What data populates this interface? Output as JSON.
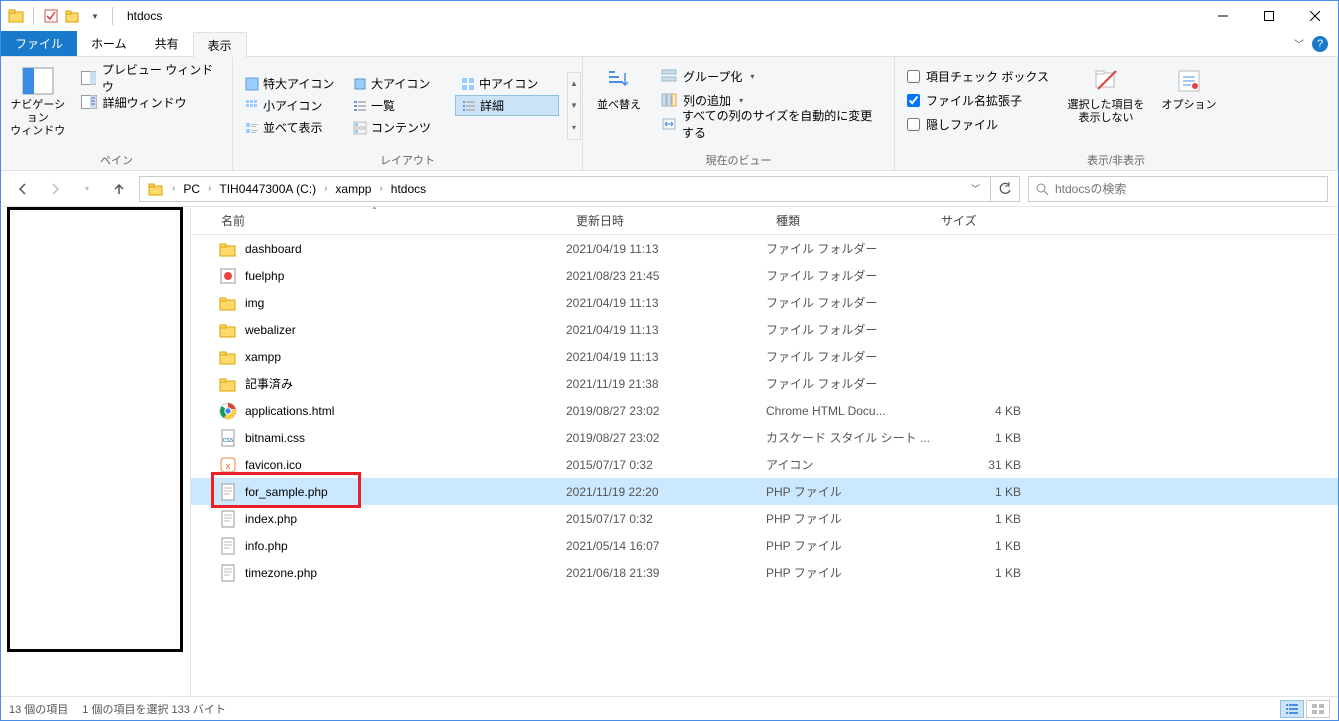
{
  "window": {
    "title": "htdocs"
  },
  "tabs": {
    "file": "ファイル",
    "home": "ホーム",
    "share": "共有",
    "view": "表示"
  },
  "ribbon": {
    "pane": {
      "nav": "ナビゲーション\nウィンドウ",
      "preview": "プレビュー ウィンドウ",
      "details": "詳細ウィンドウ",
      "label": "ペイン"
    },
    "layout": {
      "extra_large": "特大アイコン",
      "large": "大アイコン",
      "medium": "中アイコン",
      "small": "小アイコン",
      "list": "一覧",
      "details": "詳細",
      "tiles": "並べて表示",
      "content": "コンテンツ",
      "label": "レイアウト"
    },
    "current_view": {
      "sort": "並べ替え",
      "group": "グループ化",
      "add_col": "列の追加",
      "autofit": "すべての列のサイズを自動的に変更する",
      "label": "現在のビュー"
    },
    "show_hide": {
      "check_boxes": "項目チェック ボックス",
      "ext": "ファイル名拡張子",
      "hidden": "隠しファイル",
      "hide_sel": "選択した項目を\n表示しない",
      "options": "オプション",
      "label": "表示/非表示"
    }
  },
  "breadcrumb": {
    "pc": "PC",
    "drive": "TIH0447300A (C:)",
    "p1": "xampp",
    "p2": "htdocs"
  },
  "search": {
    "placeholder": "htdocsの検索"
  },
  "columns": {
    "name": "名前",
    "date": "更新日時",
    "type": "種類",
    "size": "サイズ"
  },
  "files": [
    {
      "icon": "folder",
      "name": "dashboard",
      "date": "2021/04/19 11:13",
      "type": "ファイル フォルダー",
      "size": ""
    },
    {
      "icon": "fuel",
      "name": "fuelphp",
      "date": "2021/08/23 21:45",
      "type": "ファイル フォルダー",
      "size": ""
    },
    {
      "icon": "folder",
      "name": "img",
      "date": "2021/04/19 11:13",
      "type": "ファイル フォルダー",
      "size": ""
    },
    {
      "icon": "folder",
      "name": "webalizer",
      "date": "2021/04/19 11:13",
      "type": "ファイル フォルダー",
      "size": ""
    },
    {
      "icon": "folder",
      "name": "xampp",
      "date": "2021/04/19 11:13",
      "type": "ファイル フォルダー",
      "size": ""
    },
    {
      "icon": "folder",
      "name": "記事済み",
      "date": "2021/11/19 21:38",
      "type": "ファイル フォルダー",
      "size": ""
    },
    {
      "icon": "chrome",
      "name": "applications.html",
      "date": "2019/08/27 23:02",
      "type": "Chrome HTML Docu...",
      "size": "4 KB"
    },
    {
      "icon": "css",
      "name": "bitnami.css",
      "date": "2019/08/27 23:02",
      "type": "カスケード スタイル シート ...",
      "size": "1 KB"
    },
    {
      "icon": "ico",
      "name": "favicon.ico",
      "date": "2015/07/17 0:32",
      "type": "アイコン",
      "size": "31 KB"
    },
    {
      "icon": "php",
      "name": "for_sample.php",
      "date": "2021/11/19 22:20",
      "type": "PHP ファイル",
      "size": "1 KB",
      "selected": true,
      "highlight": true
    },
    {
      "icon": "php",
      "name": "index.php",
      "date": "2015/07/17 0:32",
      "type": "PHP ファイル",
      "size": "1 KB"
    },
    {
      "icon": "php",
      "name": "info.php",
      "date": "2021/05/14 16:07",
      "type": "PHP ファイル",
      "size": "1 KB"
    },
    {
      "icon": "php",
      "name": "timezone.php",
      "date": "2021/06/18 21:39",
      "type": "PHP ファイル",
      "size": "1 KB"
    }
  ],
  "status": {
    "count": "13 個の項目",
    "selection": "1 個の項目を選択 133 バイト"
  }
}
